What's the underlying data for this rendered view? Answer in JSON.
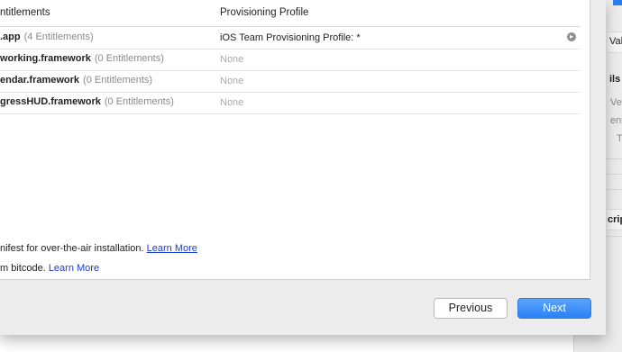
{
  "background_window": {
    "labels": [
      "Val",
      "ils",
      "Ver",
      "ent",
      "T",
      "crip"
    ]
  },
  "table": {
    "headers": {
      "entitlements": "ntitlements",
      "profile": "Provisioning Profile"
    },
    "rows": [
      {
        "name": ".app",
        "count": "(4 Entitlements)",
        "profile": "iOS Team Provisioning Profile: *",
        "has_arrow": true
      },
      {
        "name": "working.framework",
        "count": "(0 Entitlements)",
        "profile": "None",
        "has_arrow": false
      },
      {
        "name": "endar.framework",
        "count": "(0 Entitlements)",
        "profile": "None",
        "has_arrow": false
      },
      {
        "name": "gressHUD.framework",
        "count": "(0 Entitlements)",
        "profile": "None",
        "has_arrow": false
      }
    ]
  },
  "info": {
    "manifest_text": "nifest for over-the-air installation.",
    "manifest_link": "Learn More",
    "bitcode_text": "m bitcode.",
    "bitcode_link": "Learn More"
  },
  "buttons": {
    "previous": "Previous",
    "next": "Next"
  },
  "colors": {
    "accent": "#2a82f5",
    "link": "#1a3cd6",
    "sheet_bg": "#ececec"
  },
  "icons": {
    "row_arrow": "arrow-circle-right-icon"
  }
}
